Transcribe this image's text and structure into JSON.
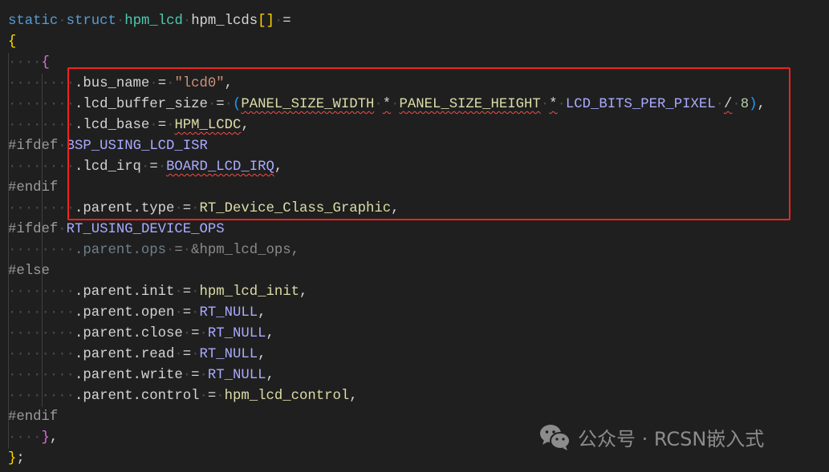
{
  "editor": {
    "lines": [
      {
        "tokens": [
          [
            "static",
            "kw"
          ],
          [
            " ",
            "ws"
          ],
          [
            "struct",
            "kw"
          ],
          [
            " ",
            "ws"
          ],
          [
            "hpm_lcd",
            "ty"
          ],
          [
            " ",
            "ws"
          ],
          [
            "hpm_lcds",
            "id"
          ],
          [
            "[]",
            "b1"
          ],
          [
            " ",
            "ws"
          ],
          [
            "=",
            "op"
          ]
        ]
      },
      {
        "tokens": [
          [
            "{",
            "b1"
          ]
        ]
      },
      {
        "tokens": [
          [
            "    ",
            "ws"
          ],
          [
            "{",
            "b2"
          ]
        ]
      },
      {
        "tokens": [
          [
            "        ",
            "ws"
          ],
          [
            ".bus_name",
            "id"
          ],
          [
            " ",
            "ws"
          ],
          [
            "=",
            "op"
          ],
          [
            " ",
            "ws"
          ],
          [
            "\"lcd0\"",
            "str"
          ],
          [
            ",",
            "op"
          ]
        ]
      },
      {
        "tokens": [
          [
            "        ",
            "ws"
          ],
          [
            ".lcd_buffer_size",
            "id"
          ],
          [
            " ",
            "ws"
          ],
          [
            "=",
            "op"
          ],
          [
            " ",
            "ws"
          ],
          [
            "(",
            "b3"
          ],
          [
            "PANEL_SIZE_WIDTH",
            "cst err"
          ],
          [
            " ",
            "ws"
          ],
          [
            "*",
            "op err"
          ],
          [
            " ",
            "ws"
          ],
          [
            "PANEL_SIZE_HEIGHT",
            "cst err"
          ],
          [
            " ",
            "ws"
          ],
          [
            "*",
            "op err"
          ],
          [
            " ",
            "ws"
          ],
          [
            "LCD_BITS_PER_PIXEL",
            "mac"
          ],
          [
            " ",
            "ws"
          ],
          [
            "/",
            "op err"
          ],
          [
            " ",
            "ws"
          ],
          [
            "8",
            "num"
          ],
          [
            ")",
            "b3"
          ],
          [
            ",",
            "op"
          ]
        ]
      },
      {
        "tokens": [
          [
            "        ",
            "ws"
          ],
          [
            ".lcd_base",
            "id"
          ],
          [
            " ",
            "ws"
          ],
          [
            "=",
            "op"
          ],
          [
            " ",
            "ws"
          ],
          [
            "HPM_LCDC",
            "cst err"
          ],
          [
            ",",
            "op"
          ]
        ]
      },
      {
        "tokens": [
          [
            "#ifdef",
            "pp"
          ],
          [
            " ",
            "ws"
          ],
          [
            "BSP_USING_LCD_ISR",
            "mac"
          ]
        ]
      },
      {
        "tokens": [
          [
            "        ",
            "ws"
          ],
          [
            ".lcd_irq",
            "id"
          ],
          [
            " ",
            "ws"
          ],
          [
            "=",
            "op"
          ],
          [
            " ",
            "ws"
          ],
          [
            "BOARD_LCD_IRQ",
            "mac err"
          ],
          [
            ",",
            "op"
          ]
        ]
      },
      {
        "tokens": [
          [
            "#endif",
            "pp"
          ]
        ]
      },
      {
        "tokens": [
          [
            "        ",
            "ws"
          ],
          [
            ".parent.type",
            "id"
          ],
          [
            " ",
            "ws"
          ],
          [
            "=",
            "op"
          ],
          [
            " ",
            "ws"
          ],
          [
            "RT_Device_Class_Graphic",
            "cst"
          ],
          [
            ",",
            "op"
          ]
        ]
      },
      {
        "tokens": [
          [
            "#ifdef",
            "pp"
          ],
          [
            " ",
            "ws"
          ],
          [
            "RT_USING_DEVICE_OPS",
            "mac"
          ]
        ]
      },
      {
        "tokens": [
          [
            "        ",
            "ws"
          ],
          [
            ".parent.ops",
            "dim"
          ],
          [
            " ",
            "ws"
          ],
          [
            "=",
            "dimw"
          ],
          [
            " ",
            "ws"
          ],
          [
            "&hpm_lcd_ops",
            "dimw"
          ],
          [
            ",",
            "dimw"
          ]
        ]
      },
      {
        "tokens": [
          [
            "#else",
            "pp"
          ]
        ]
      },
      {
        "tokens": [
          [
            "        ",
            "ws"
          ],
          [
            ".parent.init",
            "id"
          ],
          [
            " ",
            "ws"
          ],
          [
            "=",
            "op"
          ],
          [
            " ",
            "ws"
          ],
          [
            "hpm_lcd_init",
            "fn"
          ],
          [
            ",",
            "op"
          ]
        ]
      },
      {
        "tokens": [
          [
            "        ",
            "ws"
          ],
          [
            ".parent.open",
            "id"
          ],
          [
            " ",
            "ws"
          ],
          [
            "=",
            "op"
          ],
          [
            " ",
            "ws"
          ],
          [
            "RT_NULL",
            "mac"
          ],
          [
            ",",
            "op"
          ]
        ]
      },
      {
        "tokens": [
          [
            "        ",
            "ws"
          ],
          [
            ".parent.close",
            "id"
          ],
          [
            " ",
            "ws"
          ],
          [
            "=",
            "op"
          ],
          [
            " ",
            "ws"
          ],
          [
            "RT_NULL",
            "mac"
          ],
          [
            ",",
            "op"
          ]
        ]
      },
      {
        "tokens": [
          [
            "        ",
            "ws"
          ],
          [
            ".parent.read",
            "id"
          ],
          [
            " ",
            "ws"
          ],
          [
            "=",
            "op"
          ],
          [
            " ",
            "ws"
          ],
          [
            "RT_NULL",
            "mac"
          ],
          [
            ",",
            "op"
          ]
        ]
      },
      {
        "tokens": [
          [
            "        ",
            "ws"
          ],
          [
            ".parent.write",
            "id"
          ],
          [
            " ",
            "ws"
          ],
          [
            "=",
            "op"
          ],
          [
            " ",
            "ws"
          ],
          [
            "RT_NULL",
            "mac"
          ],
          [
            ",",
            "op"
          ]
        ]
      },
      {
        "tokens": [
          [
            "        ",
            "ws"
          ],
          [
            ".parent.control",
            "id"
          ],
          [
            " ",
            "ws"
          ],
          [
            "=",
            "op"
          ],
          [
            " ",
            "ws"
          ],
          [
            "hpm_lcd_control",
            "fn"
          ],
          [
            ",",
            "op"
          ]
        ]
      },
      {
        "tokens": [
          [
            "#endif",
            "pp"
          ]
        ]
      },
      {
        "tokens": [
          [
            "    ",
            "ws"
          ],
          [
            "}",
            "b2"
          ],
          [
            ",",
            "op"
          ]
        ]
      },
      {
        "tokens": [
          [
            "}",
            "b1"
          ],
          [
            ";",
            "op"
          ]
        ]
      }
    ]
  },
  "highlight_color": "#f0231e",
  "watermark": {
    "icon": "wechat-icon",
    "text": "公众号 · RCSN嵌入式"
  }
}
